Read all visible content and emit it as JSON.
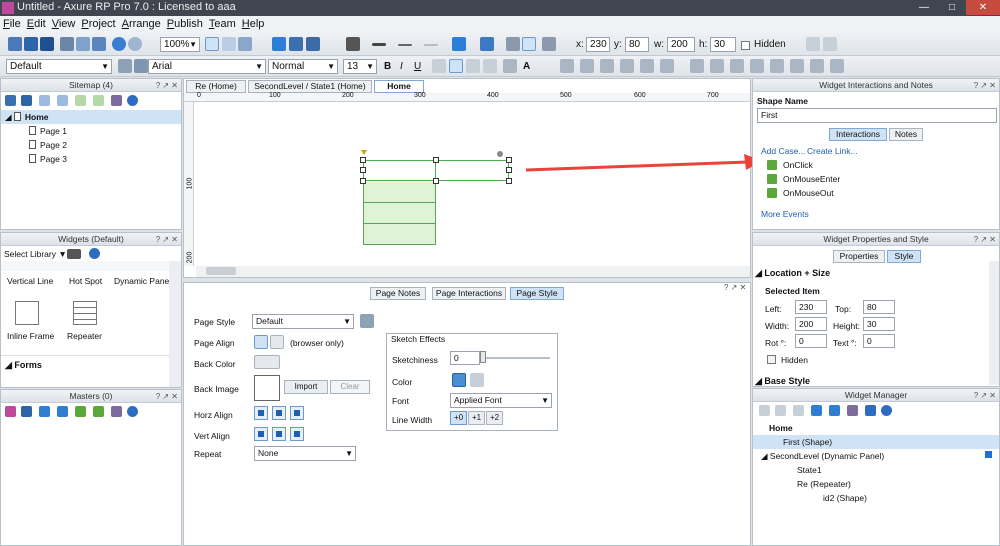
{
  "window": {
    "title": "Untitled - Axure RP Pro 7.0 : Licensed to aaa"
  },
  "menu": [
    "File",
    "Edit",
    "View",
    "Project",
    "Arrange",
    "Publish",
    "Team",
    "Help"
  ],
  "toolbar": {
    "zoom": "100%",
    "line_style": "Normal",
    "x_label": "x:",
    "x": "230",
    "y_label": "y:",
    "y": "80",
    "w_label": "w:",
    "w": "200",
    "h_label": "h:",
    "h": "30",
    "hidden_label": "Hidden",
    "style": "Default",
    "font": "Arial",
    "font_size": "13"
  },
  "sitemap": {
    "title": "Sitemap (4)",
    "pages": [
      "Home",
      "Page 1",
      "Page 2",
      "Page 3"
    ]
  },
  "widgets": {
    "title": "Widgets (Default)",
    "library_label": "Select Library",
    "row1": [
      "Vertical Line",
      "Hot Spot",
      "Dynamic Panel"
    ],
    "row2": [
      "Inline Frame",
      "Repeater"
    ],
    "section": "Forms"
  },
  "masters": {
    "title": "Masters (0)"
  },
  "tabs": [
    "Re (Home)",
    "SecondLevel / State1 (Home)",
    "Home"
  ],
  "ruler": {
    "h": [
      "0",
      "100",
      "200",
      "300",
      "400",
      "500",
      "600",
      "700"
    ],
    "v": [
      "100",
      "200"
    ]
  },
  "page_panel": {
    "tabs": [
      "Page Notes",
      "Page Interactions",
      "Page Style"
    ],
    "page_style_label": "Page Style",
    "page_style_value": "Default",
    "page_align_label": "Page Align",
    "browser_only": "(browser only)",
    "back_color_label": "Back Color",
    "back_image_label": "Back Image",
    "import_label": "Import",
    "clear_label": "Clear",
    "horz_align_label": "Horz Align",
    "vert_align_label": "Vert Align",
    "repeat_label": "Repeat",
    "repeat_value": "None",
    "sketch_title": "Sketch Effects",
    "sketchiness_label": "Sketchiness",
    "sketchiness_value": "0",
    "color_label": "Color",
    "font_label": "Font",
    "font_value": "Applied Font",
    "line_width_label": "Line Width",
    "line_widths": [
      "+0",
      "+1",
      "+2"
    ]
  },
  "interactions": {
    "title": "Widget Interactions and Notes",
    "shape_name_label": "Shape Name",
    "shape_name": "First",
    "tabs": [
      "Interactions",
      "Notes"
    ],
    "add_case": "Add Case...",
    "create_link": "Create Link...",
    "events": [
      "OnClick",
      "OnMouseEnter",
      "OnMouseOut"
    ],
    "more_events": "More Events"
  },
  "properties": {
    "title": "Widget Properties and Style",
    "tabs": [
      "Properties",
      "Style"
    ],
    "section": "Location + Size",
    "selected_item": "Selected Item",
    "left_label": "Left:",
    "left": "230",
    "top_label": "Top:",
    "top": "80",
    "width_label": "Width:",
    "width": "200",
    "height_label": "Height:",
    "height": "30",
    "rot_label": "Rot °:",
    "rot": "0",
    "text_label": "Text °:",
    "text": "0",
    "hidden_label": "Hidden",
    "base_style": "Base Style"
  },
  "manager": {
    "title": "Widget Manager",
    "items": [
      "Home",
      "First (Shape)",
      "SecondLevel (Dynamic Panel)",
      "State1",
      "Re (Repeater)",
      "id2 (Shape)"
    ]
  },
  "colors": {
    "accent": "#1f5fae",
    "selection": "#cfe3f7",
    "shape_fill": "#dff3d6",
    "arrow": "#e8443a"
  }
}
